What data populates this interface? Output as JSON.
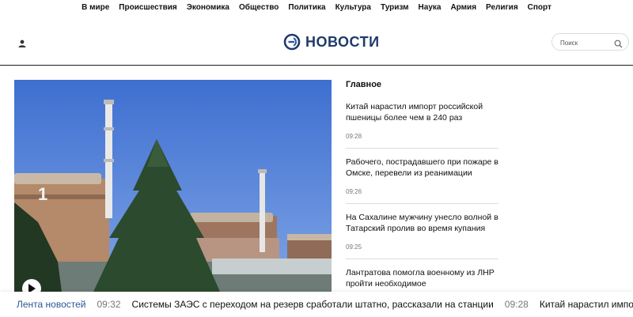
{
  "topnav": {
    "items": [
      "В мире",
      "Происшествия",
      "Экономика",
      "Общество",
      "Политика",
      "Культура",
      "Туризм",
      "Наука",
      "Армия",
      "Религия",
      "Спорт"
    ]
  },
  "header": {
    "logo_text": "НОВОСТИ",
    "search_placeholder": "Поиск",
    "icons": [
      "user-icon",
      "logo-mark-icon",
      "search-icon"
    ],
    "brand_color": "#1f3a6b"
  },
  "main": {
    "section_title": "Главное",
    "news": [
      {
        "title": "Китай нарастил импорт российской пшеницы более чем в 240 раз",
        "time": "09:28"
      },
      {
        "title": "Рабочего, пострадавшего при пожаре в Омске, перевели из реанимации",
        "time": "09:26"
      },
      {
        "title": "На Сахалине мужчину унесло волной в Татарский пролив во время купания",
        "time": "09:25"
      },
      {
        "title": "Лантратова помогла военному из ЛНР пройти необходимое",
        "time": ""
      }
    ]
  },
  "ticker": {
    "label": "Лента новостей",
    "label_color": "#2b5797",
    "items": [
      {
        "time": "09:32",
        "text": "Системы ЗАЭС с переходом на резерв сработали штатно, рассказали на станции"
      },
      {
        "time": "09:28",
        "text": "Китай нарастил импорт р"
      }
    ]
  }
}
